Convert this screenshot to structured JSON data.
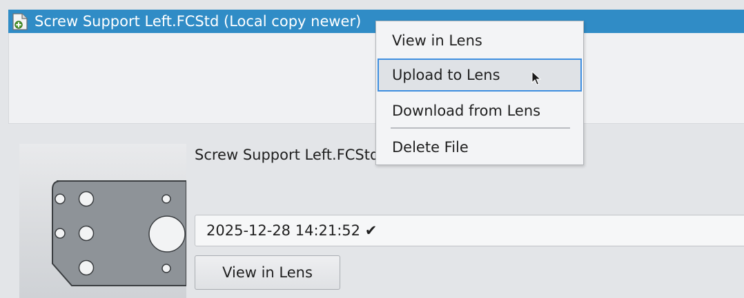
{
  "file_header": {
    "title": "Screw Support Left.FCStd (Local copy newer)",
    "icon": "freecad-document-icon",
    "background": "#308cc6"
  },
  "details": {
    "filename": "Screw Support Left.FCStd",
    "version_value": "2025-12-28 14:21:52 ✔",
    "view_button_label": "View in Lens",
    "thumbnail": "part-thumbnail"
  },
  "context_menu": {
    "items": [
      {
        "label": "View in Lens"
      },
      {
        "label": "Upload to Lens"
      },
      {
        "label": "Download from Lens"
      },
      {
        "label": "Delete File"
      }
    ],
    "highlight_color": "#3d8ee0"
  },
  "cursor": {
    "icon": "mouse-pointer-icon"
  }
}
